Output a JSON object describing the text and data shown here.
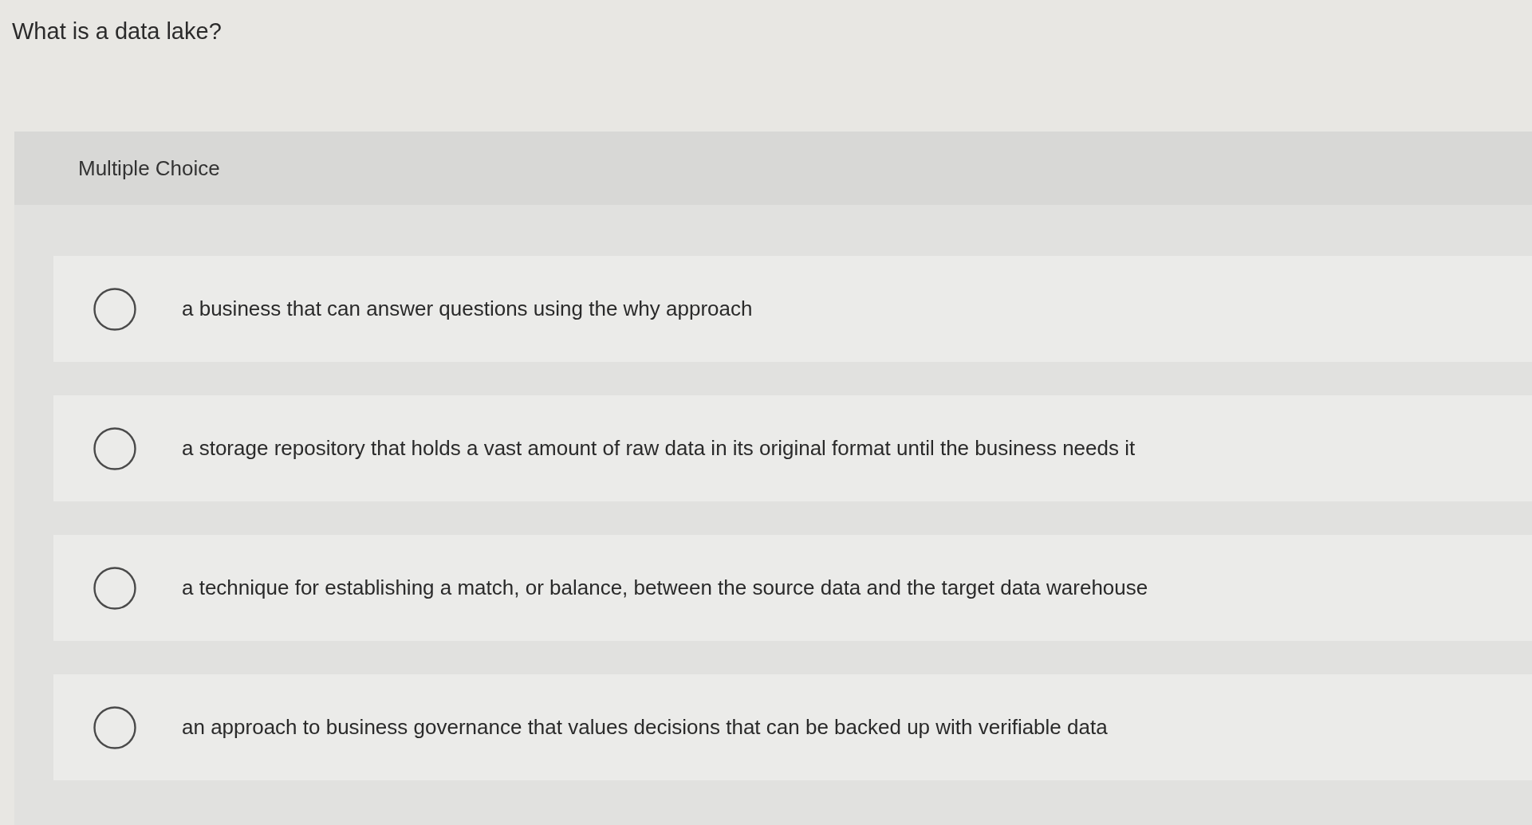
{
  "question": {
    "title": "What is a data lake?"
  },
  "panel": {
    "header": "Multiple Choice"
  },
  "options": [
    {
      "label": "a business that can answer questions using the why approach",
      "selected": false
    },
    {
      "label": "a storage repository that holds a vast amount of raw data in its original format until the business needs it",
      "selected": false
    },
    {
      "label": "a technique for establishing a match, or balance, between the source data and the target data warehouse",
      "selected": false
    },
    {
      "label": "an approach to business governance that values decisions that can be backed up with verifiable data",
      "selected": false
    }
  ]
}
